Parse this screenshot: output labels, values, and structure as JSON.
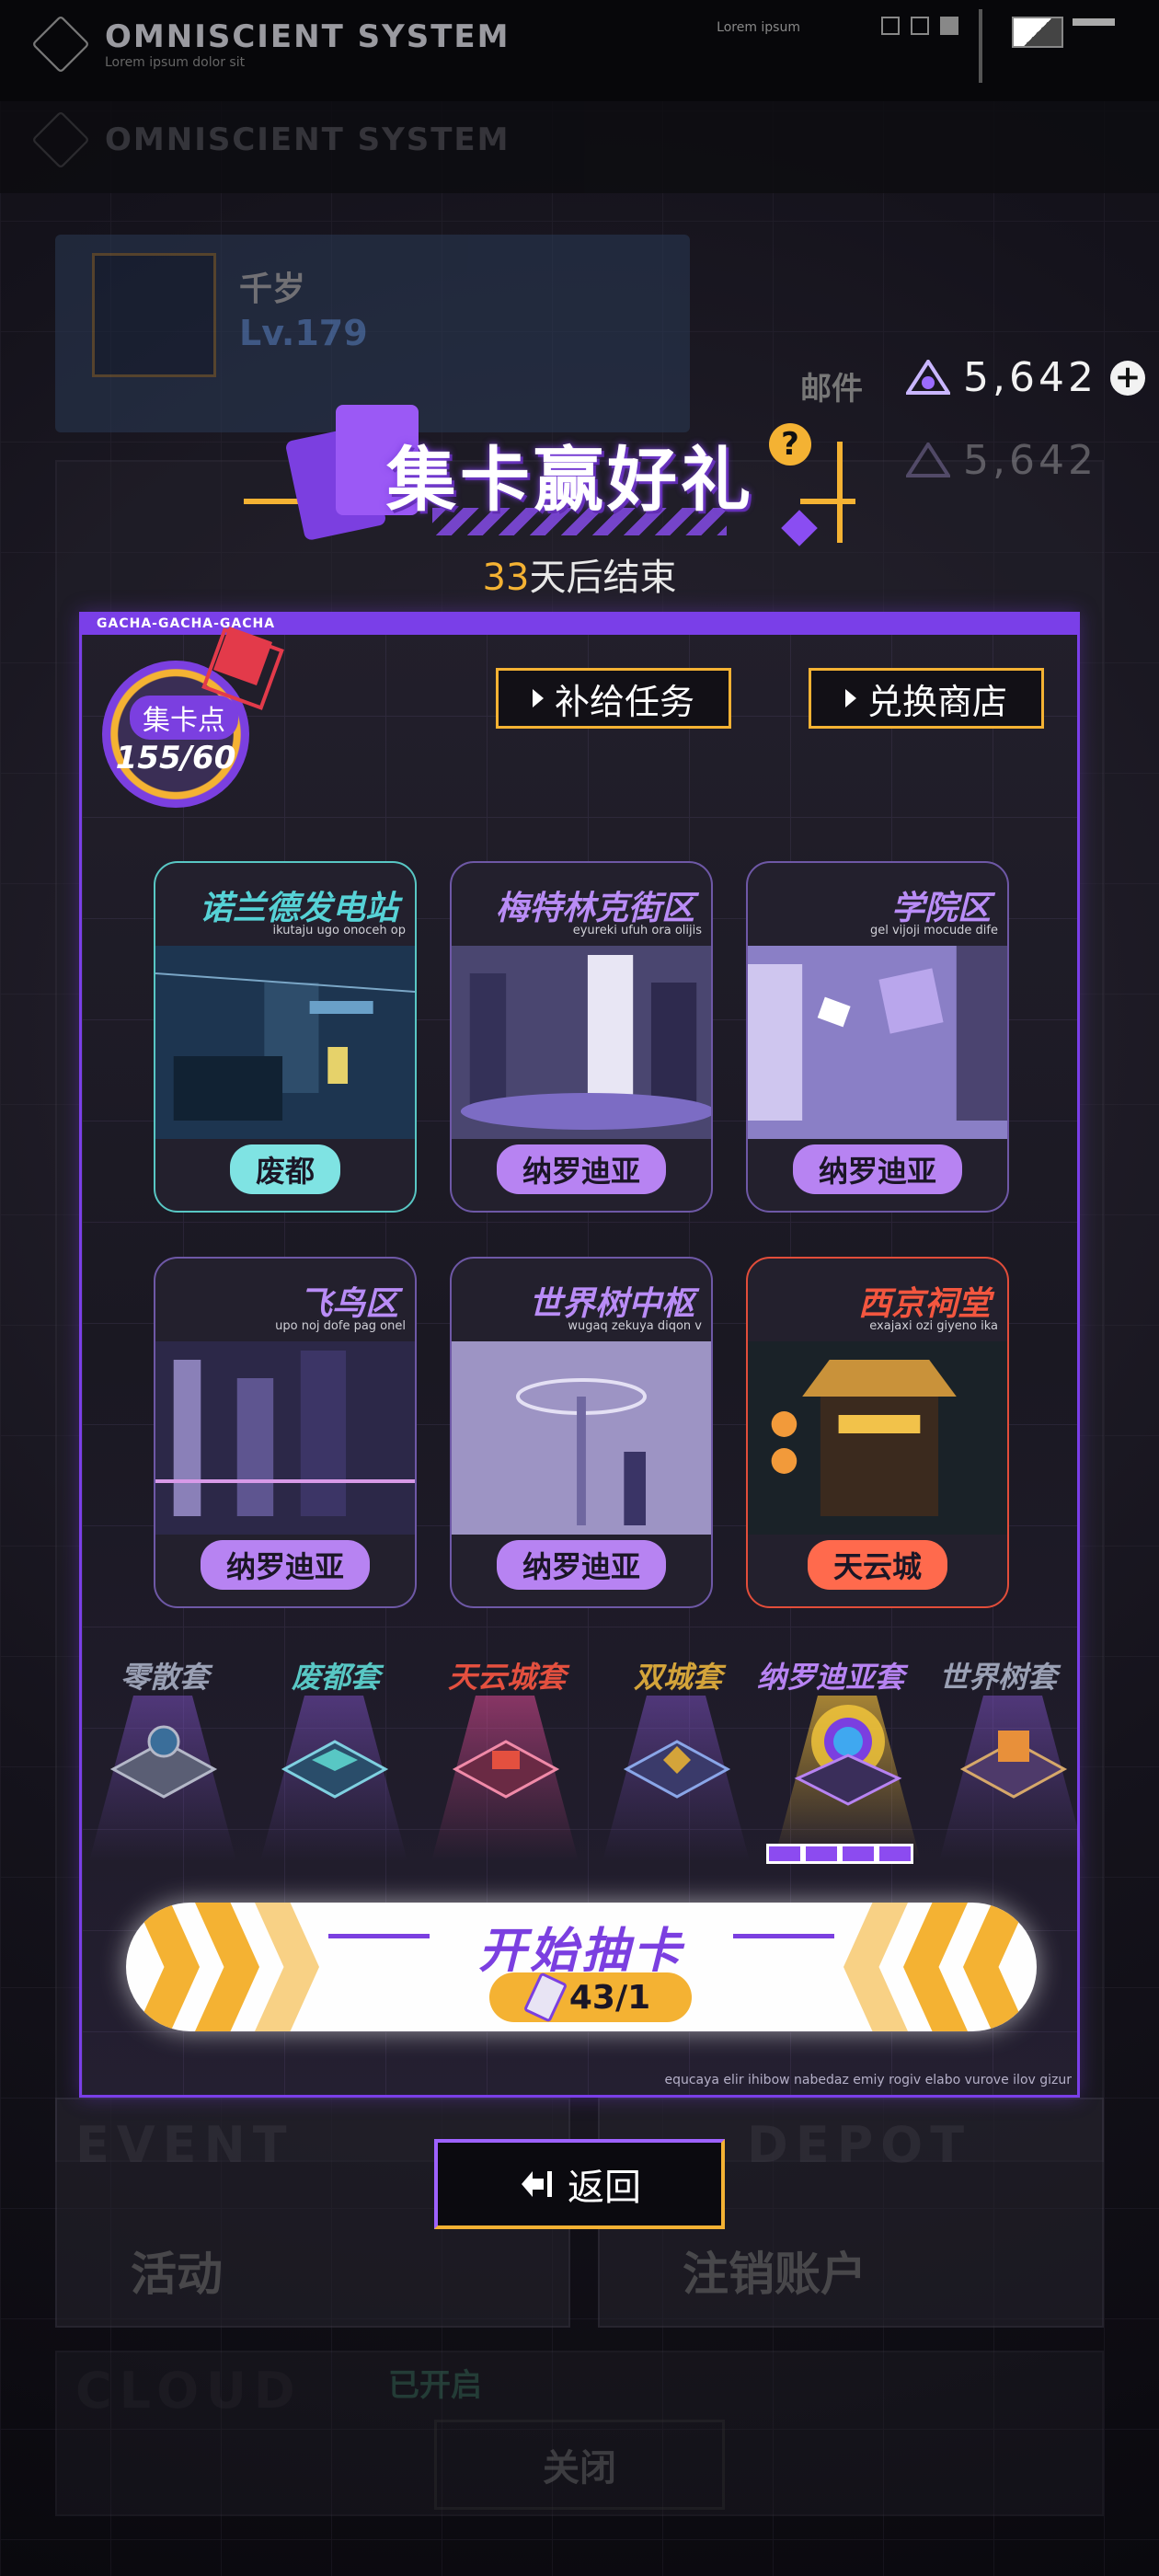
{
  "background": {
    "system_title": "OMNISCIENT SYSTEM",
    "system_subtitle": "Lorem ipsum dolor sit",
    "lorem_tag": "Lorem ipsum",
    "profile": {
      "name": "千岁",
      "level": "Lv.179"
    },
    "mail_label": "邮件",
    "event_label": "EVENT",
    "activity_label": "活动",
    "depot_label": "DEPOT",
    "logout_label": "注销账户",
    "cloud_label": "CLOUD",
    "opened_label": "已开启",
    "close_label": "关闭"
  },
  "currency": {
    "icon": "crystal-icon",
    "value": "5,642"
  },
  "event": {
    "title": "集卡赢好礼",
    "countdown_num": "33",
    "countdown_text": "天后结束"
  },
  "panel": {
    "tag": "GACHA-GACHA-GACHA",
    "points_label": "集卡点",
    "points_value": "155/60",
    "btn_supply": "补给任务",
    "btn_shop": "兑换商店",
    "footer": "equcaya elir ihibow nabedaz emiy rogiv elabo vurove ilov gizur"
  },
  "cards": [
    {
      "title": "诺兰德发电站",
      "sub": "ikutaju ugo onoceh op",
      "pill": "废都",
      "theme": "teal"
    },
    {
      "title": "梅特林克街区",
      "sub": "eyureki ufuh ora olijis",
      "pill": "纳罗迪亚",
      "theme": "purple"
    },
    {
      "title": "学院区",
      "sub": "gel vijoji mocude dife",
      "pill": "纳罗迪亚",
      "theme": "purple"
    },
    {
      "title": "飞鸟区",
      "sub": "upo noj dofe pag onel",
      "pill": "纳罗迪亚",
      "theme": "purple"
    },
    {
      "title": "世界树中枢",
      "sub": "wugaq zekuya diqon v",
      "pill": "纳罗迪亚",
      "theme": "purple"
    },
    {
      "title": "西京祠堂",
      "sub": "exajaxi ozi giyeno ika",
      "pill": "天云城",
      "theme": "red"
    }
  ],
  "series": [
    {
      "label": "零散套",
      "color": "#9aa0b4"
    },
    {
      "label": "废都套",
      "color": "#58c7c4"
    },
    {
      "label": "天云城套",
      "color": "#e4503f"
    },
    {
      "label": "双城套",
      "color": "#d4a43a"
    },
    {
      "label": "纳罗迪亚套",
      "color": "#b783f2"
    },
    {
      "label": "世界树套",
      "color": "#9aa0b4"
    }
  ],
  "series_progress": {
    "filled": 4,
    "total": 4
  },
  "draw": {
    "label": "开始抽卡",
    "cost": "43/1"
  },
  "return_label": "返回",
  "colors": {
    "accent_purple": "#7b3fe0",
    "accent_gold": "#f4b233",
    "teal": "#58c7c4",
    "red": "#e24d3a"
  }
}
